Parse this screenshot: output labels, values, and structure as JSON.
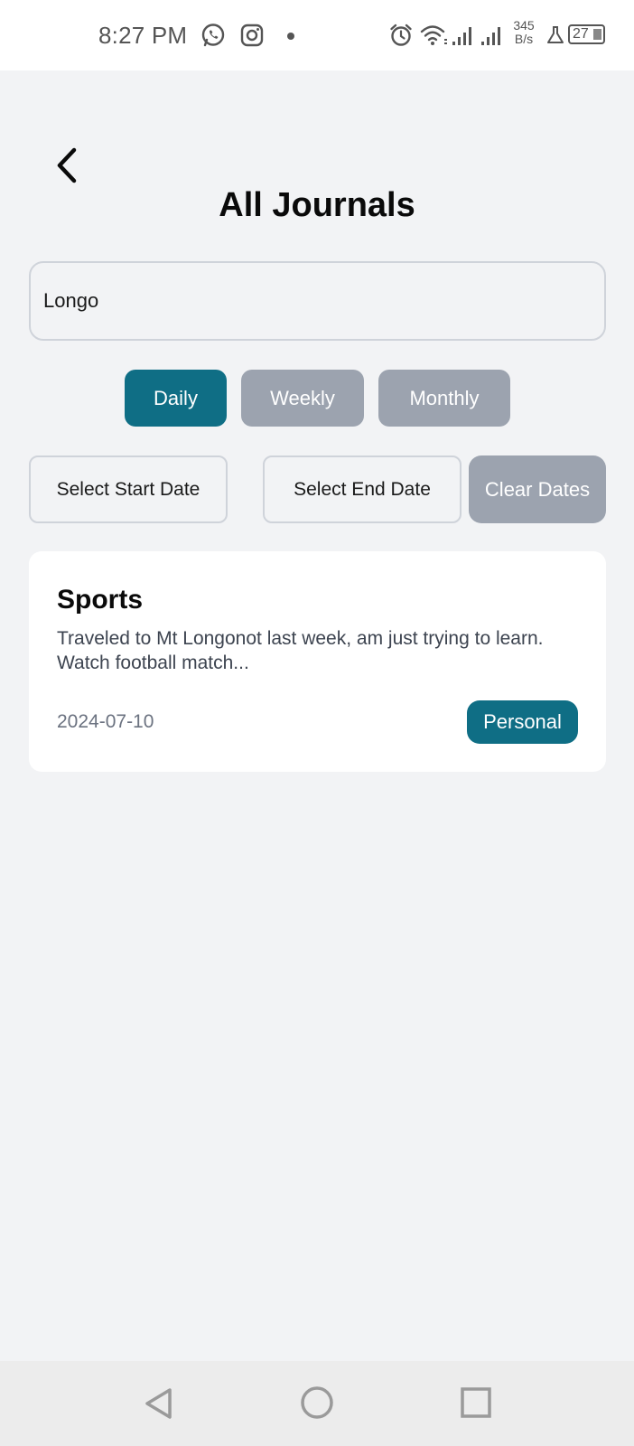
{
  "status_bar": {
    "time": "8:27 PM",
    "net_speed_value": "345",
    "net_speed_unit": "B/s",
    "battery": "27",
    "icons": [
      "whatsapp-icon",
      "instagram-icon",
      "alarm-icon",
      "wifi-icon",
      "signal-icon",
      "signal-icon",
      "lab-flask-icon",
      "battery-icon"
    ]
  },
  "header": {
    "title": "All Journals",
    "back_icon": "chevron-left-icon"
  },
  "search": {
    "value": "Longo"
  },
  "period_tabs": [
    {
      "label": "Daily",
      "active": true
    },
    {
      "label": "Weekly",
      "active": false
    },
    {
      "label": "Monthly",
      "active": false
    }
  ],
  "date_filters": {
    "start_label": "Select Start Date",
    "end_label": "Select End Date",
    "clear_label": "Clear Dates"
  },
  "journals": [
    {
      "title": "Sports",
      "excerpt": "Traveled to Mt Longonot last week, am just trying to learn.\nWatch football match...",
      "date": "2024-07-10",
      "tag": "Personal"
    }
  ],
  "colors": {
    "accent": "#0f6e85",
    "inactive": "#9ca3af",
    "background": "#f2f3f5"
  },
  "nav_bar": {
    "icons": [
      "back-triangle-icon",
      "home-circle-icon",
      "recents-square-icon"
    ]
  }
}
